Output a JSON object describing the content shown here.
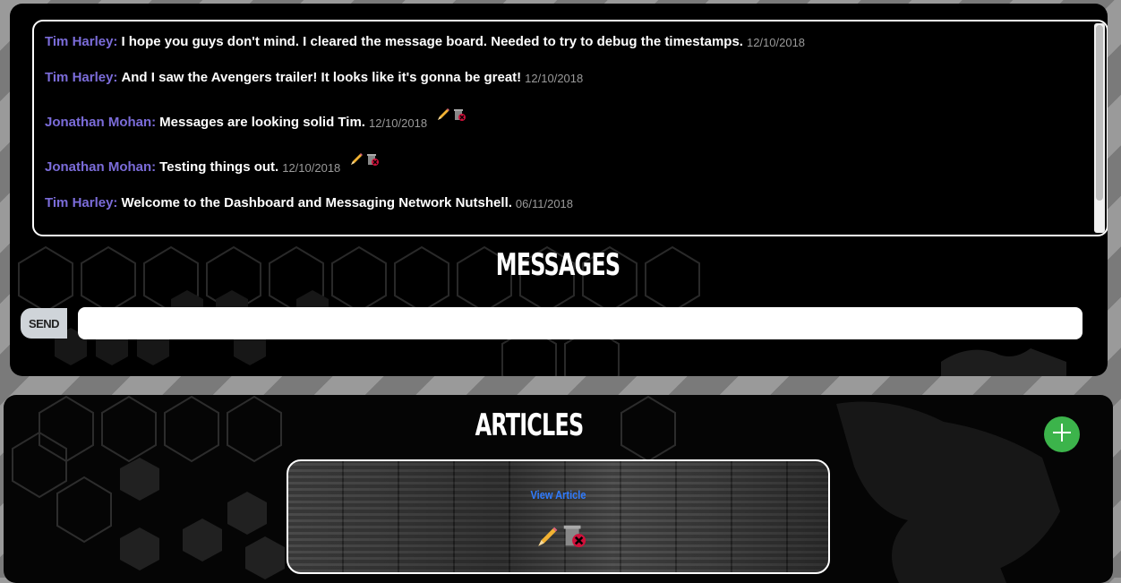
{
  "messages_panel": {
    "title": "MESSAGES",
    "send_label": "SEND",
    "input_value": "",
    "input_placeholder": "",
    "messages": [
      {
        "author": "Tim Harley:",
        "text": "I hope you guys don't mind. I cleared the message board. Needed to try to debug the timestamps.",
        "date": "12/10/2018",
        "editable": false
      },
      {
        "author": "Tim Harley:",
        "text": "And I saw the Avengers trailer! It looks like it's gonna be great!",
        "date": "12/10/2018",
        "editable": false
      },
      {
        "author": "Jonathan Mohan:",
        "text": "Messages are looking solid Tim.",
        "date": "12/10/2018",
        "editable": true
      },
      {
        "author": "Jonathan Mohan:",
        "text": "Testing things out.",
        "date": "12/10/2018",
        "editable": true
      },
      {
        "author": "Tim Harley:",
        "text": "Welcome to the Dashboard and Messaging Network Nutshell.",
        "date": "06/11/2018",
        "editable": false
      }
    ]
  },
  "articles_panel": {
    "title": "ARTICLES",
    "article_link_label": "View Article"
  },
  "icons": {
    "edit": "pencil-icon",
    "delete": "trash-icon",
    "add": "plus-icon"
  },
  "colors": {
    "author": "#7b6cd9",
    "add_button": "#3cb44b",
    "link": "#2f7bff"
  }
}
